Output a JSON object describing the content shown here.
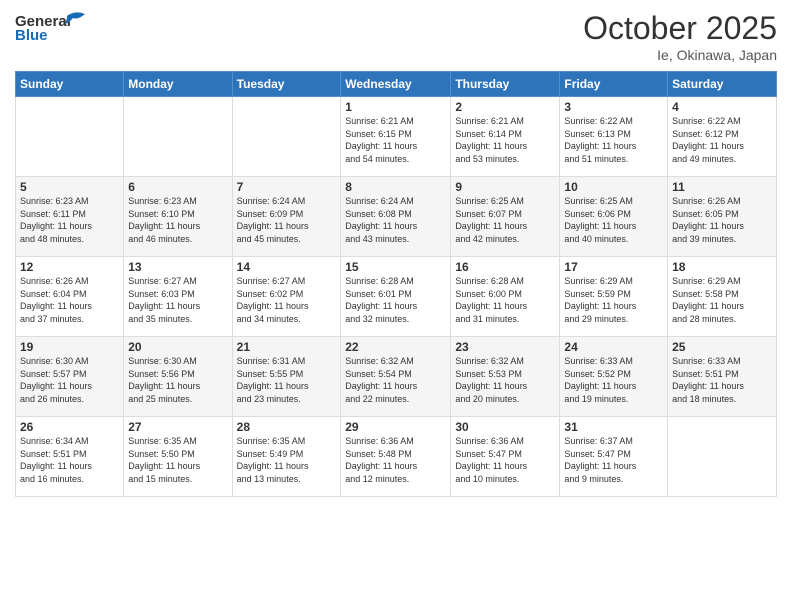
{
  "header": {
    "logo_general": "General",
    "logo_blue": "Blue",
    "month_title": "October 2025",
    "location": "Ie, Okinawa, Japan"
  },
  "days_of_week": [
    "Sunday",
    "Monday",
    "Tuesday",
    "Wednesday",
    "Thursday",
    "Friday",
    "Saturday"
  ],
  "weeks": [
    [
      {
        "day": "",
        "info": ""
      },
      {
        "day": "",
        "info": ""
      },
      {
        "day": "",
        "info": ""
      },
      {
        "day": "1",
        "info": "Sunrise: 6:21 AM\nSunset: 6:15 PM\nDaylight: 11 hours\nand 54 minutes."
      },
      {
        "day": "2",
        "info": "Sunrise: 6:21 AM\nSunset: 6:14 PM\nDaylight: 11 hours\nand 53 minutes."
      },
      {
        "day": "3",
        "info": "Sunrise: 6:22 AM\nSunset: 6:13 PM\nDaylight: 11 hours\nand 51 minutes."
      },
      {
        "day": "4",
        "info": "Sunrise: 6:22 AM\nSunset: 6:12 PM\nDaylight: 11 hours\nand 49 minutes."
      }
    ],
    [
      {
        "day": "5",
        "info": "Sunrise: 6:23 AM\nSunset: 6:11 PM\nDaylight: 11 hours\nand 48 minutes."
      },
      {
        "day": "6",
        "info": "Sunrise: 6:23 AM\nSunset: 6:10 PM\nDaylight: 11 hours\nand 46 minutes."
      },
      {
        "day": "7",
        "info": "Sunrise: 6:24 AM\nSunset: 6:09 PM\nDaylight: 11 hours\nand 45 minutes."
      },
      {
        "day": "8",
        "info": "Sunrise: 6:24 AM\nSunset: 6:08 PM\nDaylight: 11 hours\nand 43 minutes."
      },
      {
        "day": "9",
        "info": "Sunrise: 6:25 AM\nSunset: 6:07 PM\nDaylight: 11 hours\nand 42 minutes."
      },
      {
        "day": "10",
        "info": "Sunrise: 6:25 AM\nSunset: 6:06 PM\nDaylight: 11 hours\nand 40 minutes."
      },
      {
        "day": "11",
        "info": "Sunrise: 6:26 AM\nSunset: 6:05 PM\nDaylight: 11 hours\nand 39 minutes."
      }
    ],
    [
      {
        "day": "12",
        "info": "Sunrise: 6:26 AM\nSunset: 6:04 PM\nDaylight: 11 hours\nand 37 minutes."
      },
      {
        "day": "13",
        "info": "Sunrise: 6:27 AM\nSunset: 6:03 PM\nDaylight: 11 hours\nand 35 minutes."
      },
      {
        "day": "14",
        "info": "Sunrise: 6:27 AM\nSunset: 6:02 PM\nDaylight: 11 hours\nand 34 minutes."
      },
      {
        "day": "15",
        "info": "Sunrise: 6:28 AM\nSunset: 6:01 PM\nDaylight: 11 hours\nand 32 minutes."
      },
      {
        "day": "16",
        "info": "Sunrise: 6:28 AM\nSunset: 6:00 PM\nDaylight: 11 hours\nand 31 minutes."
      },
      {
        "day": "17",
        "info": "Sunrise: 6:29 AM\nSunset: 5:59 PM\nDaylight: 11 hours\nand 29 minutes."
      },
      {
        "day": "18",
        "info": "Sunrise: 6:29 AM\nSunset: 5:58 PM\nDaylight: 11 hours\nand 28 minutes."
      }
    ],
    [
      {
        "day": "19",
        "info": "Sunrise: 6:30 AM\nSunset: 5:57 PM\nDaylight: 11 hours\nand 26 minutes."
      },
      {
        "day": "20",
        "info": "Sunrise: 6:30 AM\nSunset: 5:56 PM\nDaylight: 11 hours\nand 25 minutes."
      },
      {
        "day": "21",
        "info": "Sunrise: 6:31 AM\nSunset: 5:55 PM\nDaylight: 11 hours\nand 23 minutes."
      },
      {
        "day": "22",
        "info": "Sunrise: 6:32 AM\nSunset: 5:54 PM\nDaylight: 11 hours\nand 22 minutes."
      },
      {
        "day": "23",
        "info": "Sunrise: 6:32 AM\nSunset: 5:53 PM\nDaylight: 11 hours\nand 20 minutes."
      },
      {
        "day": "24",
        "info": "Sunrise: 6:33 AM\nSunset: 5:52 PM\nDaylight: 11 hours\nand 19 minutes."
      },
      {
        "day": "25",
        "info": "Sunrise: 6:33 AM\nSunset: 5:51 PM\nDaylight: 11 hours\nand 18 minutes."
      }
    ],
    [
      {
        "day": "26",
        "info": "Sunrise: 6:34 AM\nSunset: 5:51 PM\nDaylight: 11 hours\nand 16 minutes."
      },
      {
        "day": "27",
        "info": "Sunrise: 6:35 AM\nSunset: 5:50 PM\nDaylight: 11 hours\nand 15 minutes."
      },
      {
        "day": "28",
        "info": "Sunrise: 6:35 AM\nSunset: 5:49 PM\nDaylight: 11 hours\nand 13 minutes."
      },
      {
        "day": "29",
        "info": "Sunrise: 6:36 AM\nSunset: 5:48 PM\nDaylight: 11 hours\nand 12 minutes."
      },
      {
        "day": "30",
        "info": "Sunrise: 6:36 AM\nSunset: 5:47 PM\nDaylight: 11 hours\nand 10 minutes."
      },
      {
        "day": "31",
        "info": "Sunrise: 6:37 AM\nSunset: 5:47 PM\nDaylight: 11 hours\nand 9 minutes."
      },
      {
        "day": "",
        "info": ""
      }
    ]
  ]
}
